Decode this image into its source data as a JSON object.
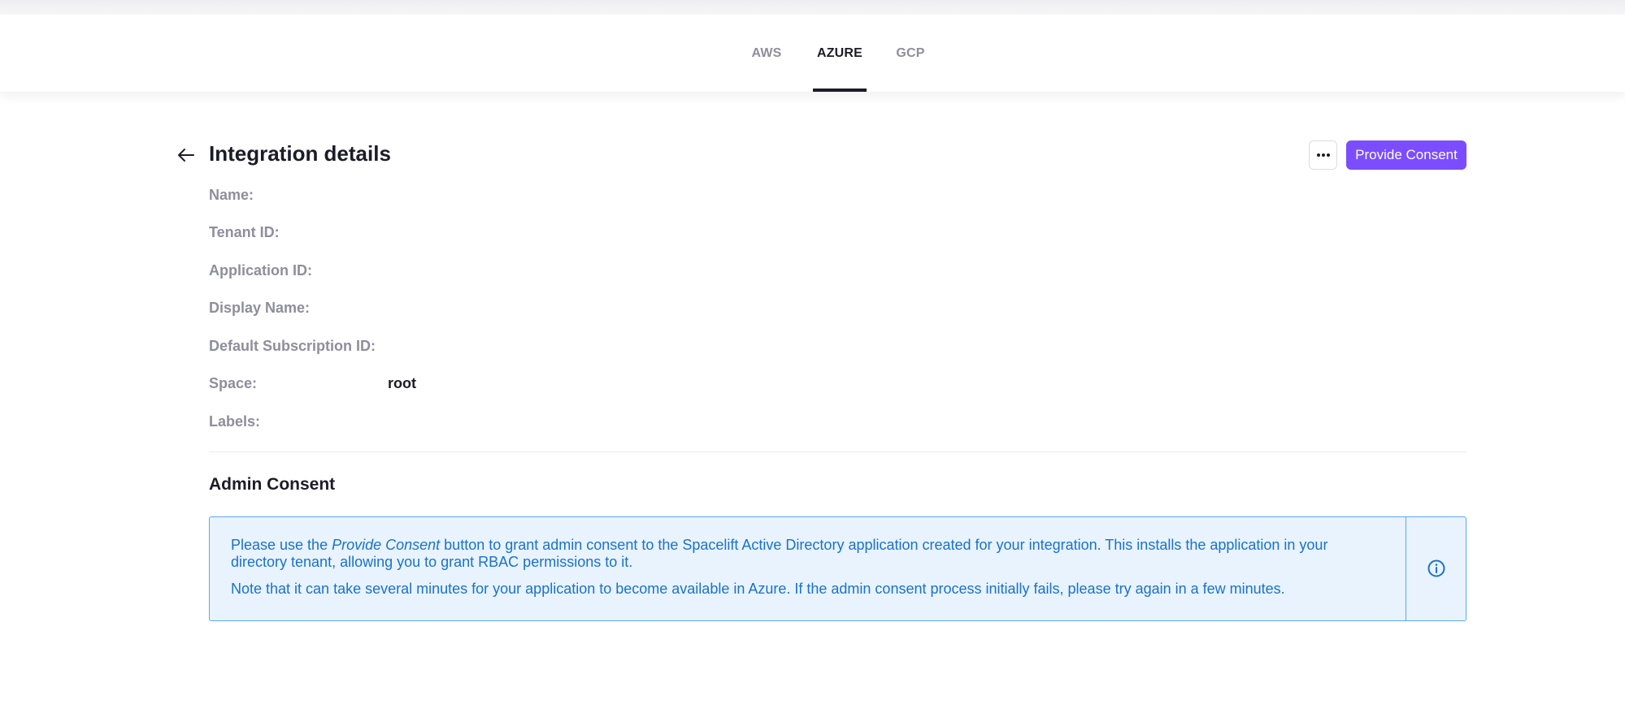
{
  "tabs": [
    {
      "label": "AWS",
      "active": false
    },
    {
      "label": "AZURE",
      "active": true
    },
    {
      "label": "GCP",
      "active": false
    }
  ],
  "header": {
    "title": "Integration details",
    "back_icon": "arrow-left-icon",
    "more_icon": "more-horizontal-icon",
    "consent_button": "Provide Consent"
  },
  "details": {
    "name": {
      "label": "Name:",
      "value": ""
    },
    "tenant_id": {
      "label": "Tenant ID:",
      "value": ""
    },
    "application_id": {
      "label": "Application ID:",
      "value": ""
    },
    "display_name": {
      "label": "Display Name:",
      "value": ""
    },
    "default_subscription_id": {
      "label": "Default Subscription ID:",
      "value": ""
    },
    "space": {
      "label": "Space:",
      "value": "root"
    },
    "labels": {
      "label": "Labels:",
      "value": ""
    }
  },
  "admin_consent": {
    "title": "Admin Consent",
    "line1_prefix": "Please use the ",
    "line1_emphasis": "Provide Consent",
    "line1_suffix": " button to grant admin consent to the Spacelift Active Directory application created for your integration. This installs the application in your directory tenant, allowing you to grant RBAC permissions to it.",
    "line2": "Note that it can take several minutes for your application to become available in Azure. If the admin consent process initially fails, please try again in a few minutes.",
    "icon": "info-icon"
  },
  "colors": {
    "accent": "#7b4dff",
    "info_text": "#1a72c9",
    "info_border": "#5aa8ee",
    "info_background": "#e8f3fe"
  }
}
